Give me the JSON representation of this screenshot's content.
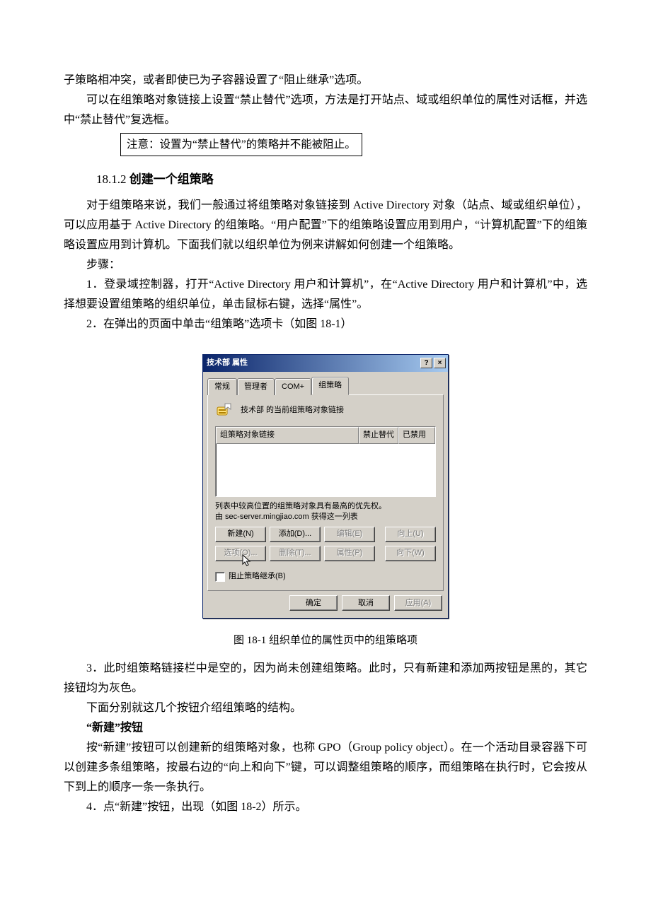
{
  "body": {
    "p1": "子策略相冲突，或者即使已为子容器设置了“阻止继承”选项。",
    "p2": "可以在组策略对象链接上设置“禁止替代”选项，方法是打开站点、域或组织单位的属性对话框，并选中“禁止替代”复选框。",
    "note": "注意：设置为“禁止替代”的策略并不能被阻止。",
    "section_num": "18.1.2 ",
    "section_title": "创建一个组策略",
    "p3": "对于组策略来说，我们一般通过将组策略对象链接到 Active Directory 对象（站点、域或组织单位），可以应用基于 Active Directory 的组策略。“用户配置”下的组策略设置应用到用户，“计算机配置”下的组策略设置应用到计算机。下面我们就以组织单位为例来讲解如何创建一个组策略。",
    "p_steps": "步骤：",
    "p_s1": "1．登录域控制器，打开“Active Directory 用户和计算机”，在“Active Directory 用户和计算机”中，选择想要设置组策略的组织单位，单击鼠标右键，选择“属性”。",
    "p_s2": "2．在弹出的页面中单击“组策略”选项卡（如图 18-1）",
    "fig_caption": "图 18-1  组织单位的属性页中的组策略项",
    "p_s3": "3．此时组策略链接栏中是空的，因为尚未创建组策略。此时，只有新建和添加两按钮是黑的，其它接钮均为灰色。",
    "p4": "下面分别就这几个按钮介绍组策略的结构。",
    "p5": "“新建”按钮",
    "p6": "按“新建”按钮可以创建新的组策略对象，也称 GPO（Group policy object）。在一个活动目录容器下可以创建多条组策略，按最右边的“向上和向下”键，可以调整组策略的顺序，而组策略在执行时，它会按从下到上的顺序一条一条执行。",
    "p_s4": "4．点“新建”按钮，出现（如图 18-2）所示。"
  },
  "dialog": {
    "title": "技术部  属性",
    "tabs": [
      "常规",
      "管理者",
      "COM+",
      "组策略"
    ],
    "active_tab": 3,
    "header_text": "技术部 的当前组策略对象链接",
    "columns": [
      "组策略对象链接",
      "禁止替代",
      "已禁用"
    ],
    "hint_line1": "列表中较高位置的组策略对象具有最高的优先权。",
    "hint_line2": "由 sec-server.mingjiao.com 获得这一列表",
    "buttons": {
      "new": "新建(N)",
      "add": "添加(D)...",
      "edit": "编辑(E)",
      "up": "向上(U)",
      "options": "选项(O)...",
      "delete": "删除(T)...",
      "properties": "属性(P)",
      "down": "向下(W)"
    },
    "block_inherit": "阻止策略继承(B)",
    "footer": {
      "ok": "确定",
      "cancel": "取消",
      "apply": "应用(A)"
    }
  }
}
